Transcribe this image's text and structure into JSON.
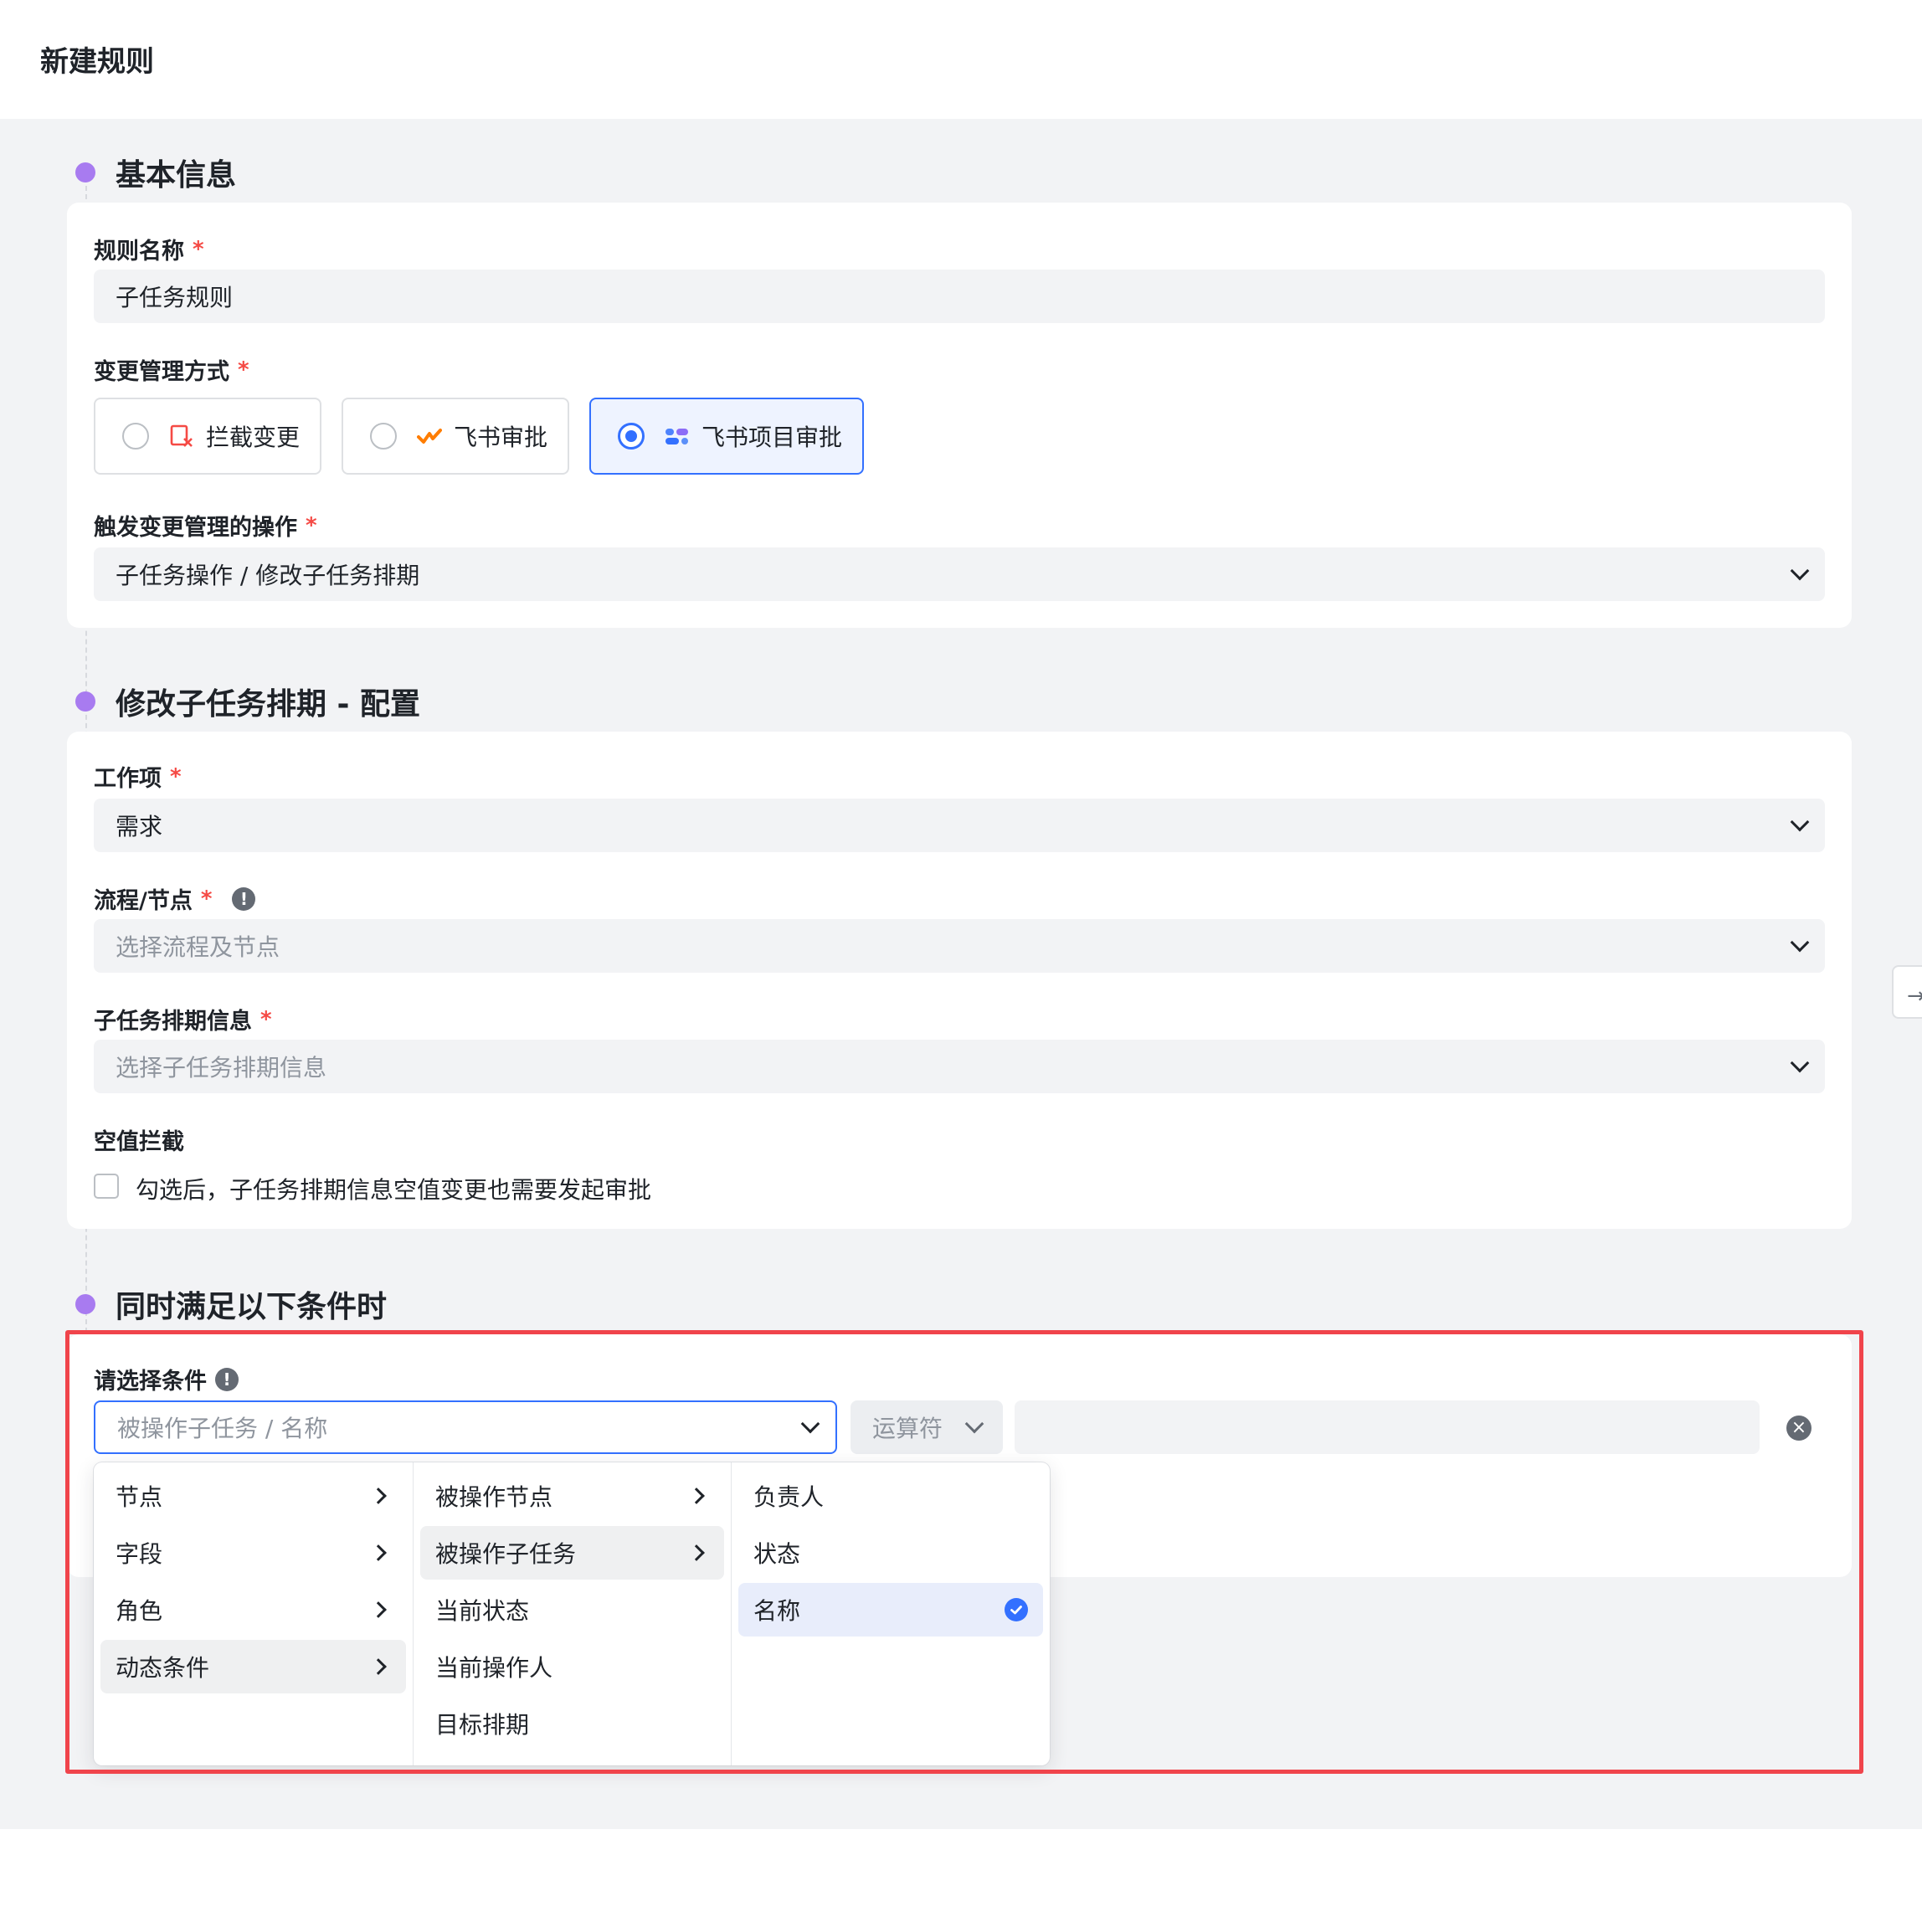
{
  "page": {
    "title": "新建规则"
  },
  "sections": {
    "basic": {
      "title": "基本信息"
    },
    "config": {
      "title": "修改子任务排期 - 配置"
    },
    "conditions": {
      "title": "同时满足以下条件时"
    }
  },
  "basic": {
    "rule_name": {
      "label": "规则名称",
      "required_mark": "*",
      "value": "子任务规则"
    },
    "change_mode": {
      "label": "变更管理方式",
      "required_mark": "*",
      "options": [
        {
          "label": "拦截变更",
          "icon": "block-change-icon",
          "selected": false
        },
        {
          "label": "飞书审批",
          "icon": "feishu-approval-icon",
          "selected": false
        },
        {
          "label": "飞书项目审批",
          "icon": "feishu-project-icon",
          "selected": true
        }
      ]
    },
    "trigger": {
      "label": "触发变更管理的操作",
      "required_mark": "*",
      "value": "子任务操作 / 修改子任务排期"
    }
  },
  "config": {
    "work_item": {
      "label": "工作项",
      "required_mark": "*",
      "value": "需求"
    },
    "flow_node": {
      "label": "流程/节点",
      "required_mark": "*",
      "info_icon": "!",
      "placeholder": "选择流程及节点"
    },
    "schedule_info": {
      "label": "子任务排期信息",
      "required_mark": "*",
      "placeholder": "选择子任务排期信息"
    },
    "empty_block": {
      "label": "空值拦截",
      "checkbox_text": "勾选后，子任务排期信息空值变更也需要发起审批",
      "checked": false
    }
  },
  "conditions": {
    "label": "请选择条件",
    "info_icon": "!",
    "field_placeholder": "被操作子任务 / 名称",
    "operator_placeholder": "运算符",
    "clear_icon": "×",
    "cascader": {
      "col1": [
        "节点",
        "字段",
        "角色",
        "动态条件"
      ],
      "col1_active": "动态条件",
      "col2": [
        "被操作节点",
        "被操作子任务",
        "当前状态",
        "当前操作人",
        "目标排期"
      ],
      "col2_active": "被操作子任务",
      "col3": [
        "负责人",
        "状态",
        "名称"
      ],
      "col3_selected": "名称"
    }
  },
  "side_tab": {
    "glyph": "→"
  },
  "colors": {
    "accent": "#3370ff",
    "section_dot": "#a87bf0",
    "required": "#f54a45",
    "highlight_border": "#f0444b",
    "page_bg": "#f2f3f5"
  }
}
